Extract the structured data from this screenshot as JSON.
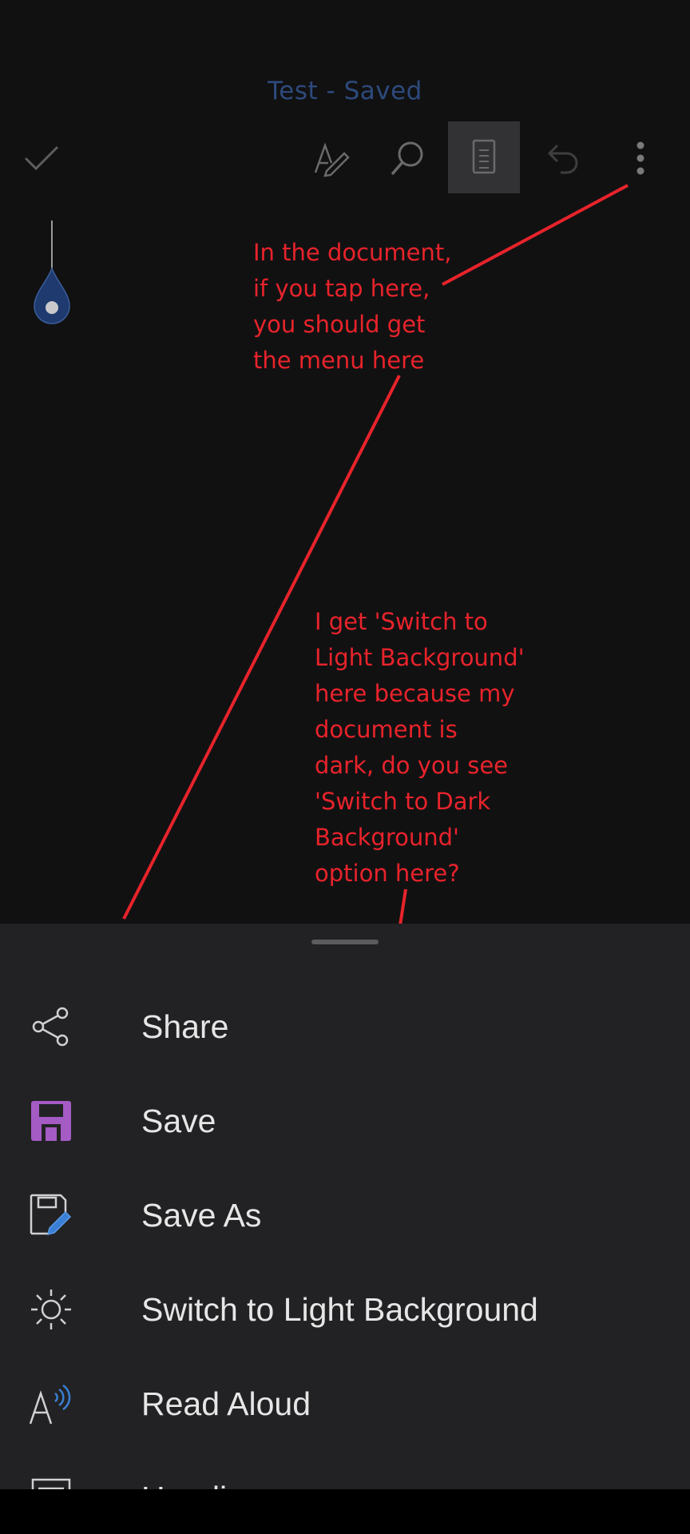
{
  "header": {
    "title": "Test - Saved"
  },
  "toolbar": {
    "icons": [
      "checkmark-icon",
      "draw-pen-icon",
      "search-icon",
      "mobile-view-icon",
      "undo-icon",
      "more-options-icon"
    ]
  },
  "annotations": {
    "note1": "In the document,\nif you tap here,\nyou should get\nthe menu here",
    "note2": "I get 'Switch to\nLight Background'\nhere because my\ndocument is\ndark, do you see\n'Switch to Dark\nBackground'\noption here?",
    "color": "#e8232b"
  },
  "menu": {
    "items": [
      {
        "label": "Share",
        "icon": "share-icon"
      },
      {
        "label": "Save",
        "icon": "save-icon"
      },
      {
        "label": "Save As",
        "icon": "save-as-icon"
      },
      {
        "label": "Switch to Light Background",
        "icon": "sun-icon"
      },
      {
        "label": "Read Aloud",
        "icon": "read-aloud-icon"
      },
      {
        "label": "Headings",
        "icon": "headings-icon"
      }
    ]
  },
  "colors": {
    "accent": "#2d4a7c",
    "save_icon": "#a45bc4",
    "background": "#111112",
    "sheet": "#222224"
  }
}
